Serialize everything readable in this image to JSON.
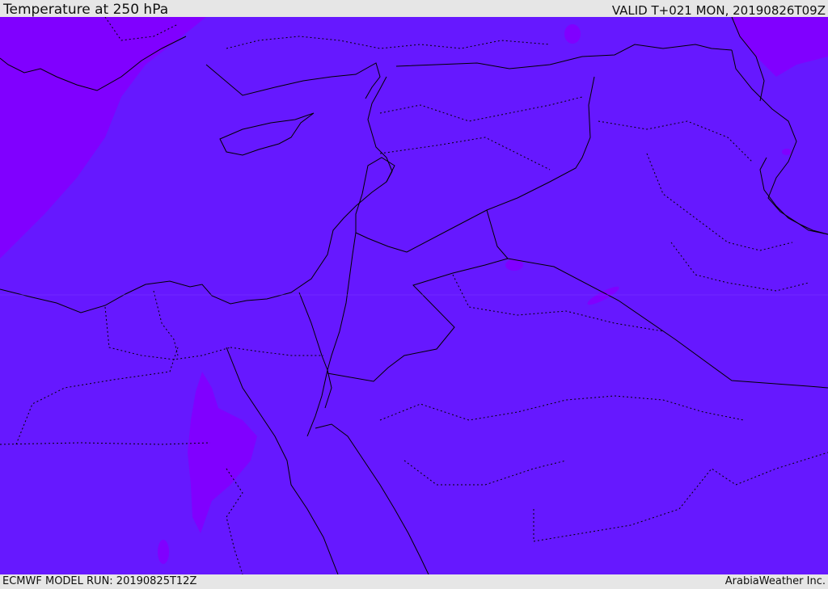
{
  "header": {
    "title": "Temperature at 250 hPa",
    "valid": "VALID T+021 MON, 20190826T09Z"
  },
  "footer": {
    "model_run": "ECMWF MODEL RUN: 20190825T12Z",
    "credit": "ArabiaWeather Inc."
  },
  "colors": {
    "background_field": "#6618ff",
    "warm_field": "#8000ff",
    "border_line": "#000000",
    "header_bg": "#e6e6e6"
  }
}
